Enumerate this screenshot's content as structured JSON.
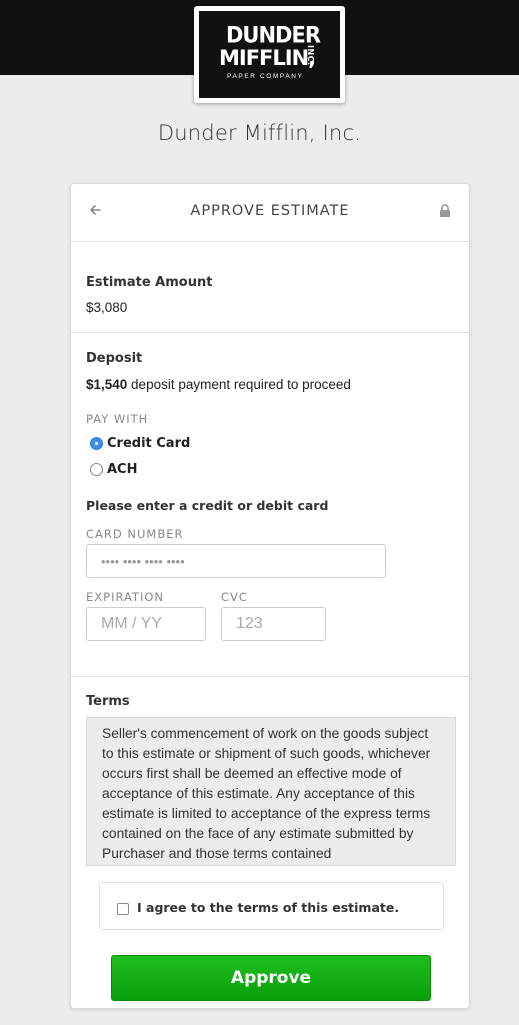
{
  "logo": {
    "line1": "DUNDER",
    "line2": "MIFFLIN,",
    "inc": "INC.",
    "sub": "PAPER COMPANY"
  },
  "company_name": "Dunder Mifflin, Inc.",
  "header": {
    "back_icon": "arrow-left-icon",
    "title": "APPROVE ESTIMATE",
    "lock_icon": "lock-icon"
  },
  "estimate": {
    "label": "Estimate Amount",
    "amount": "$3,080"
  },
  "deposit": {
    "label": "Deposit",
    "amount": "$1,540",
    "suffix": " deposit payment required to proceed"
  },
  "pay_with": {
    "label": "PAY WITH",
    "options": [
      {
        "label": "Credit Card",
        "selected": true
      },
      {
        "label": "ACH",
        "selected": false
      }
    ]
  },
  "card_form": {
    "prompt": "Please enter a credit or debit card",
    "card_number_label": "CARD NUMBER",
    "card_number_placeholder": "•••• •••• •••• ••••",
    "expiration_label": "EXPIRATION",
    "expiration_placeholder": "MM / YY",
    "cvc_label": "CVC",
    "cvc_placeholder": "123"
  },
  "terms": {
    "label": "Terms",
    "text": "Seller's commencement of work on the goods subject to this estimate or shipment of such goods, whichever occurs first shall be deemed an effective mode of acceptance of this estimate. Any acceptance of this estimate is limited to acceptance of the express terms contained on the face of any estimate submitted by Purchaser and those terms contained"
  },
  "agree": {
    "label": "I agree to the terms of this estimate.",
    "checked": false
  },
  "approve_button": "Approve",
  "colors": {
    "topbar": "#111111",
    "radio_selected": "#3b8fe6",
    "approve": "#13b013"
  }
}
